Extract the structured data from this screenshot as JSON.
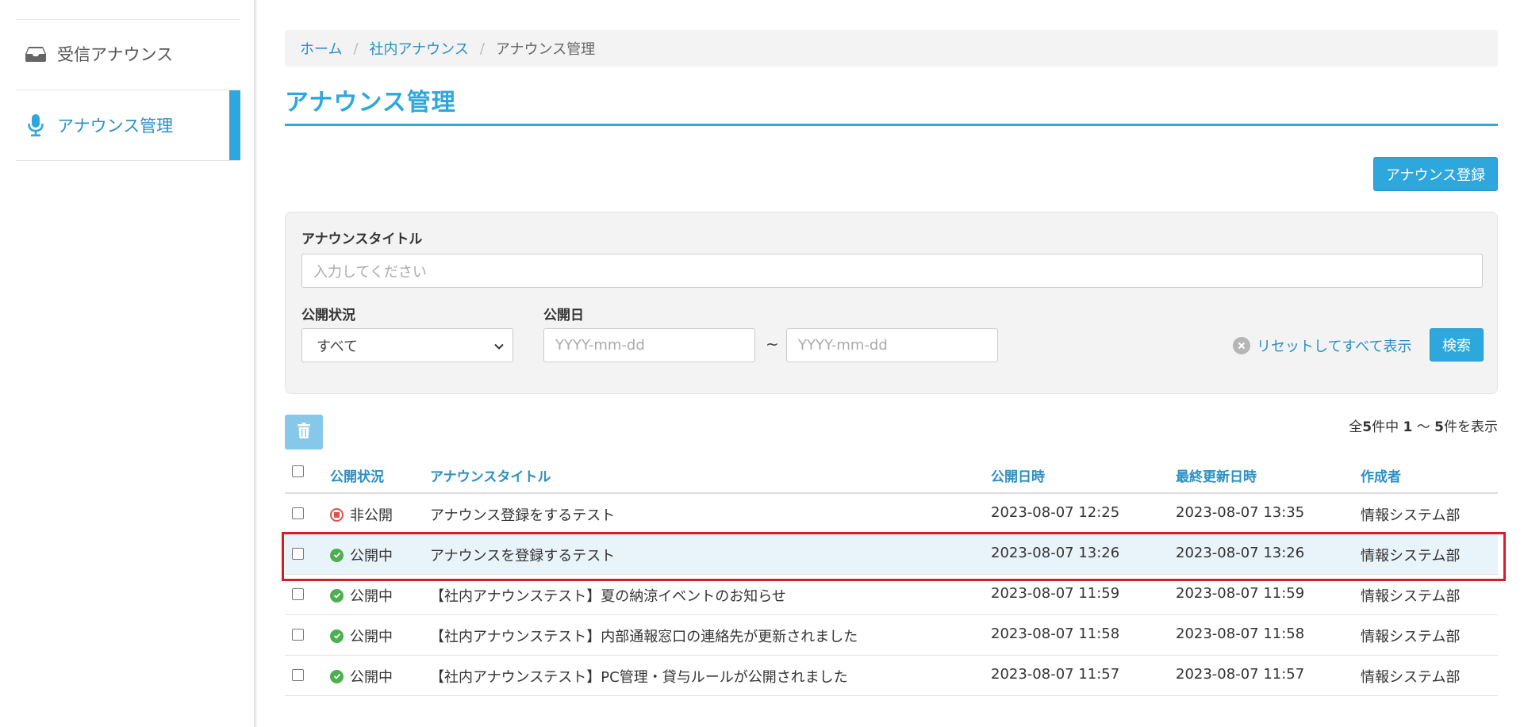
{
  "sidebar": {
    "items": [
      {
        "label": "受信アナウンス",
        "icon": "inbox-icon",
        "active": false
      },
      {
        "label": "アナウンス管理",
        "icon": "microphone-icon",
        "active": true
      }
    ]
  },
  "breadcrumb": {
    "items": [
      "ホーム",
      "社内アナウンス"
    ],
    "current": "アナウンス管理",
    "separator": "/"
  },
  "page": {
    "title": "アナウンス管理",
    "register_button": "アナウンス登録"
  },
  "search": {
    "title_label": "アナウンスタイトル",
    "title_placeholder": "入力してください",
    "status_label": "公開状況",
    "status_selected": "すべて",
    "date_label": "公開日",
    "date_from_placeholder": "YYYY-mm-dd",
    "date_to_placeholder": "YYYY-mm-dd",
    "date_separator": "~",
    "reset_label": "リセットしてすべて表示",
    "search_button": "検索"
  },
  "list": {
    "count_prefix": "全",
    "total": "5",
    "count_mid": "件中 ",
    "from": "1",
    "range_sep": " 〜 ",
    "to": "5",
    "count_suffix": "件を表示"
  },
  "table": {
    "headers": {
      "status": "公開状況",
      "title": "アナウンスタイトル",
      "published": "公開日時",
      "updated": "最終更新日時",
      "author": "作成者"
    },
    "rows": [
      {
        "status": "非公開",
        "status_type": "unpublished",
        "title": "アナウンス登録をするテスト",
        "published": "2023-08-07 12:25",
        "updated": "2023-08-07 13:35",
        "author": "情報システム部"
      },
      {
        "status": "公開中",
        "status_type": "published",
        "title": "アナウンスを登録するテスト",
        "published": "2023-08-07 13:26",
        "updated": "2023-08-07 13:26",
        "author": "情報システム部"
      },
      {
        "status": "公開中",
        "status_type": "published",
        "title": "【社内アナウンステスト】夏の納涼イベントのお知らせ",
        "published": "2023-08-07 11:59",
        "updated": "2023-08-07 11:59",
        "author": "情報システム部"
      },
      {
        "status": "公開中",
        "status_type": "published",
        "title": "【社内アナウンステスト】内部通報窓口の連絡先が更新されました",
        "published": "2023-08-07 11:58",
        "updated": "2023-08-07 11:58",
        "author": "情報システム部"
      },
      {
        "status": "公開中",
        "status_type": "published",
        "title": "【社内アナウンステスト】PC管理・貸与ルールが公開されました",
        "published": "2023-08-07 11:57",
        "updated": "2023-08-07 11:57",
        "author": "情報システム部"
      }
    ]
  },
  "colors": {
    "accent": "#2ea8dc",
    "link": "#2c8fc4",
    "published_status": "#4caf50",
    "unpublished_status": "#d9534f",
    "highlight_border": "#d81b2b"
  }
}
